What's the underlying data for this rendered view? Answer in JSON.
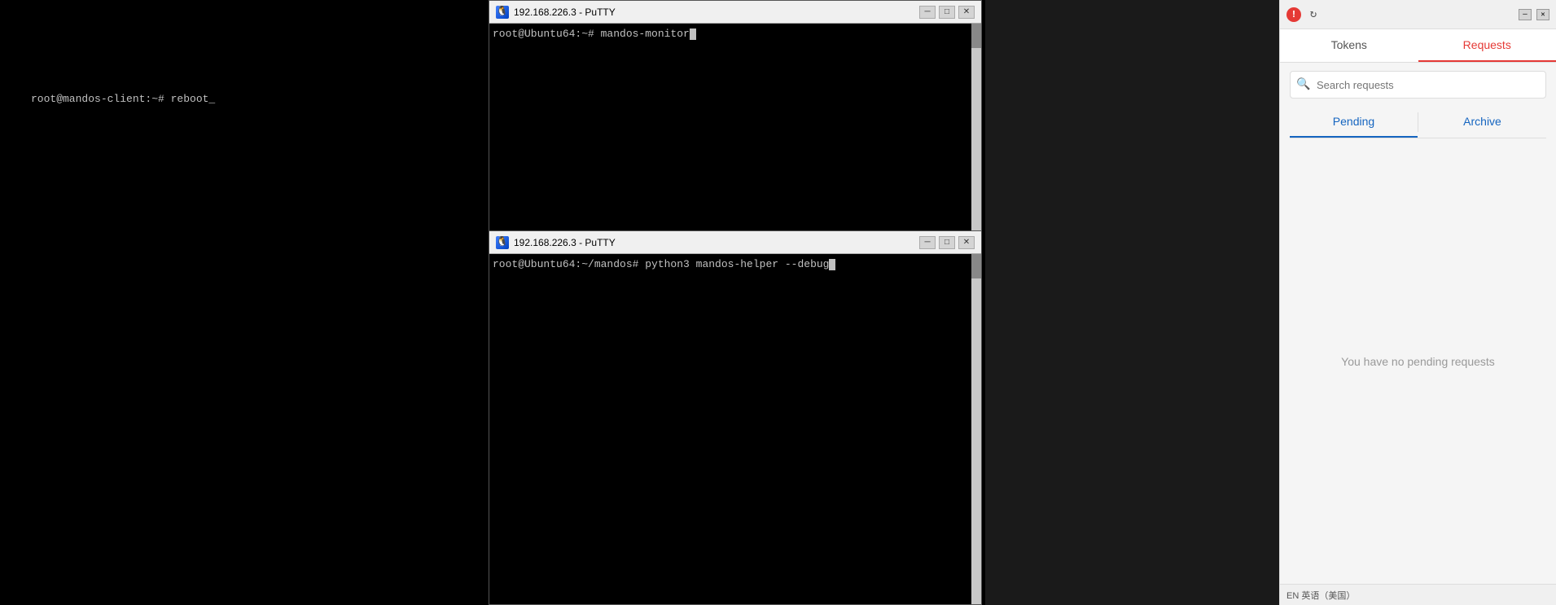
{
  "terminal_bg": {
    "text": "root@mandos-client:~# reboot_"
  },
  "putty1": {
    "title": "192.168.226.3 - PuTTY",
    "icon": "🐧",
    "line": "root@Ubuntu64:~# mandos-monitor",
    "min_label": "─",
    "max_label": "□",
    "close_label": "✕"
  },
  "putty2": {
    "title": "192.168.226.3 - PuTTY",
    "icon": "🐧",
    "line": "root@Ubuntu64:~/mandos# python3 mandos-helper --debug",
    "min_label": "─",
    "max_label": "□",
    "close_label": "✕"
  },
  "right_panel": {
    "error_icon": "!",
    "refresh_icon": "↻",
    "min_label": "─",
    "close_label": "✕",
    "tabs": [
      {
        "id": "tokens",
        "label": "Tokens",
        "active": false
      },
      {
        "id": "requests",
        "label": "Requests",
        "active": true
      }
    ],
    "search_placeholder": "Search requests",
    "sub_tabs": [
      {
        "id": "pending",
        "label": "Pending",
        "active": true
      },
      {
        "id": "archive",
        "label": "Archive",
        "active": false
      }
    ],
    "empty_state": "You have no pending requests",
    "bottom_bar": "EN 英语（美国）"
  }
}
